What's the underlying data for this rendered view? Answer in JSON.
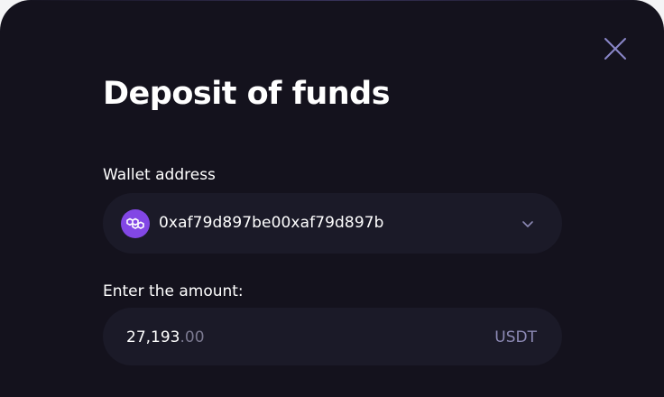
{
  "modal": {
    "title": "Deposit of funds",
    "close_icon": "close-icon"
  },
  "wallet": {
    "label": "Wallet address",
    "network_icon": "polygon-icon",
    "address": "0xaf79d897be00xaf79d897b",
    "dropdown_icon": "chevron-down-icon"
  },
  "amount": {
    "label": "Enter the amount:",
    "integer_part": "27,193",
    "decimal_part": ".00",
    "currency": "USDT"
  },
  "colors": {
    "background": "#14121d",
    "field_background": "#1b1a28",
    "accent": "#8247e5",
    "muted_text": "#8c89b4"
  }
}
